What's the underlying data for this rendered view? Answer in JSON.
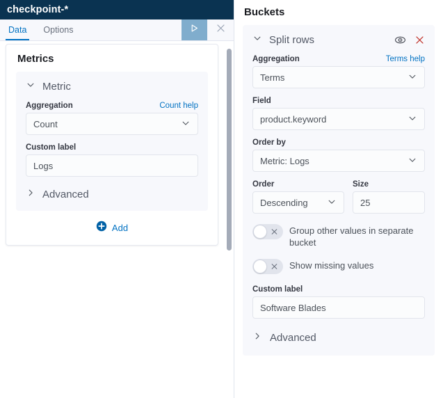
{
  "left_panel": {
    "title": "checkpoint-*",
    "tabs": [
      {
        "label": "Data",
        "active": true
      },
      {
        "label": "Options",
        "active": false
      }
    ],
    "toolbar": {
      "apply_icon": "play-triangle-icon",
      "close_icon": "close-icon"
    },
    "metrics": {
      "heading": "Metrics",
      "metric_accordion": {
        "label": "Metric",
        "expanded": true,
        "aggregation": {
          "label": "Aggregation",
          "help_link": "Count help",
          "value": "Count"
        },
        "custom_label": {
          "label": "Custom label",
          "value": "Logs"
        },
        "advanced": {
          "label": "Advanced",
          "expanded": false
        }
      },
      "add_button": {
        "label": "Add",
        "icon": "plus-circle-icon"
      }
    }
  },
  "right_panel": {
    "heading": "Buckets",
    "split_rows": {
      "label": "Split rows",
      "expanded": true,
      "eye_icon": "eye-icon",
      "remove_icon": "close-x-icon",
      "aggregation": {
        "label": "Aggregation",
        "help_link": "Terms help",
        "value": "Terms"
      },
      "field": {
        "label": "Field",
        "value": "product.keyword"
      },
      "order_by": {
        "label": "Order by",
        "value": "Metric: Logs"
      },
      "order": {
        "label": "Order",
        "value": "Descending"
      },
      "size": {
        "label": "Size",
        "value": "25"
      },
      "group_other": {
        "label": "Group other values in separate bucket",
        "enabled": false
      },
      "show_missing": {
        "label": "Show missing values",
        "enabled": false
      },
      "custom_label": {
        "label": "Custom label",
        "value": "Software Blades"
      },
      "advanced": {
        "label": "Advanced",
        "expanded": false
      }
    }
  },
  "colors": {
    "header_bg": "#0a3351",
    "accent_blue": "#0071c2",
    "play_bg": "#80adcd",
    "panel_bg": "#f7f8fc",
    "danger_red": "#bd271e"
  }
}
